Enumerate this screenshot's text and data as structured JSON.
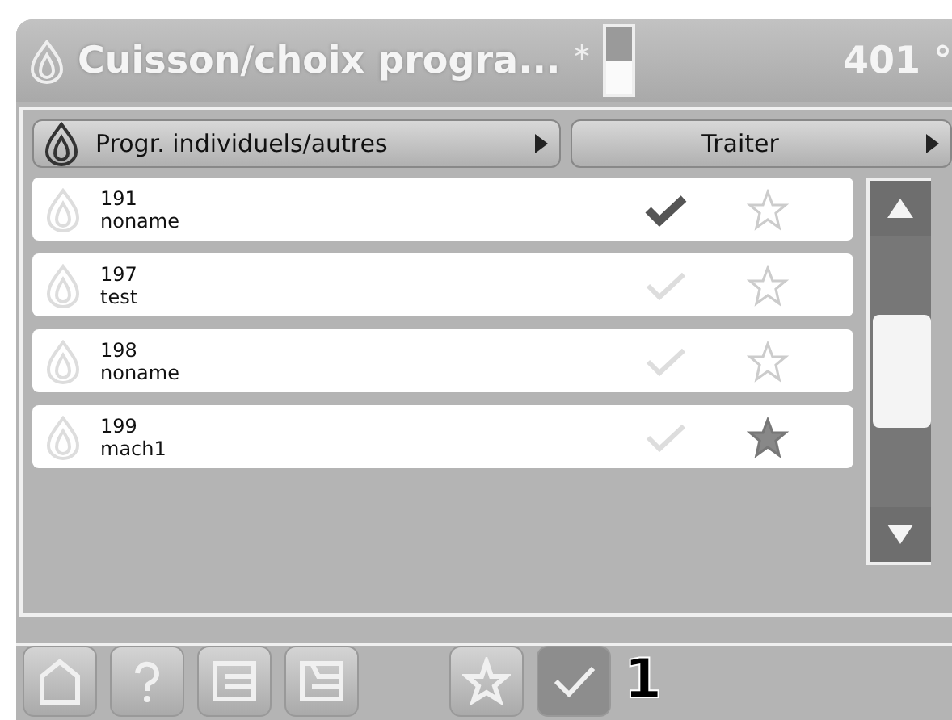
{
  "header": {
    "title": "Cuisson/choix progra...",
    "temperature": "401 °",
    "level": 0.5
  },
  "toolbar": {
    "category": "Progr. individuels/autres",
    "action": "Traiter"
  },
  "programs": [
    {
      "number": "191",
      "name": "noname",
      "checked": true,
      "favorite": false
    },
    {
      "number": "197",
      "name": "test",
      "checked": false,
      "favorite": false
    },
    {
      "number": "198",
      "name": "noname",
      "checked": false,
      "favorite": false
    },
    {
      "number": "199",
      "name": "mach1",
      "checked": false,
      "favorite": true
    }
  ],
  "footer": {
    "buttons": [
      {
        "kind": "home",
        "selected": false
      },
      {
        "kind": "help",
        "selected": false
      },
      {
        "kind": "list",
        "selected": false
      },
      {
        "kind": "list-alt",
        "selected": false
      },
      {
        "kind": "star",
        "selected": false
      },
      {
        "kind": "check",
        "selected": true
      }
    ],
    "count": "1"
  }
}
